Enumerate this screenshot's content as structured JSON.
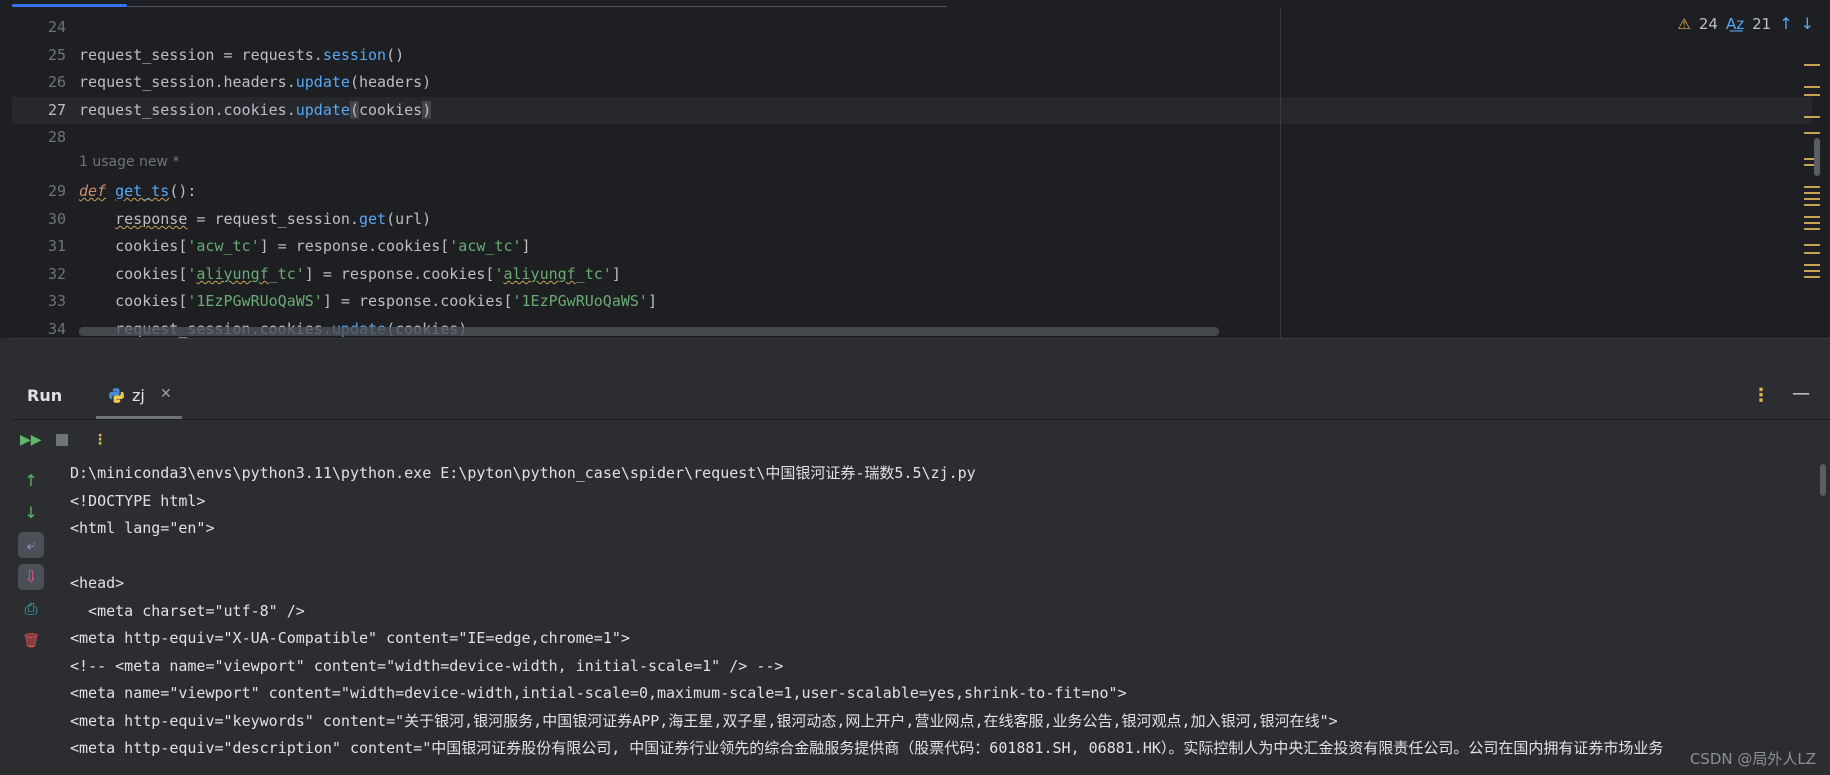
{
  "editor": {
    "line_numbers": [
      "24",
      "25",
      "26",
      "27",
      "28",
      "29",
      "30",
      "31",
      "32",
      "33",
      "34"
    ],
    "current_line": "27",
    "usage_hint": "1 usage   new *",
    "code": {
      "l25": {
        "a": "request_session = requests.",
        "fn": "session",
        "b": "()"
      },
      "l26": {
        "a": "request_session.headers.",
        "fn": "update",
        "b": "(headers)"
      },
      "l27": {
        "a": "request_session.cookies.",
        "fn": "update",
        "p1": "(",
        "arg": "cookies",
        "p2": ")"
      },
      "l29": {
        "kw": "def",
        "sp": " ",
        "name": "get_ts",
        "rest": "():"
      },
      "l30": {
        "indent": "    ",
        "var": "response",
        "a": " = request_session.",
        "fn": "get",
        "b": "(url)"
      },
      "l31": {
        "a": "    cookies[",
        "s1": "'acw_tc'",
        "b": "] = response.cookies[",
        "s2": "'acw_tc'",
        "c": "]"
      },
      "l32": {
        "a": "    cookies[",
        "s1q": "'",
        "s1u": "aliyungf",
        "s1r": "_tc'",
        "b": "] = response.cookies[",
        "s2q": "'",
        "s2u": "aliyungf",
        "s2r": "_tc'",
        "c": "]"
      },
      "l33": {
        "a": "    cookies[",
        "s1": "'1EzPGwRUoQaWS'",
        "b": "] = response.cookies[",
        "s2": "'1EzPGwRUoQaWS'",
        "c": "]"
      },
      "l34": {
        "a": "    request_session.cookies.",
        "fn": "update",
        "b": "(cookies)"
      }
    },
    "inspections": {
      "warnings": "24",
      "typos": "21",
      "up": "↑",
      "down": "↓"
    }
  },
  "run": {
    "title": "Run",
    "tab_label": "zj",
    "tab_close": "✕",
    "more": "⋮",
    "minimize": "—",
    "toolbar": {
      "rerun": "▶▶",
      "more": "⋮"
    },
    "side": {
      "up": "↑",
      "down": "↓",
      "wrap": "⤶",
      "scroll_end": "⇩",
      "print": "⎙",
      "delete": "🗑"
    },
    "console_lines": [
      "D:\\miniconda3\\envs\\python3.11\\python.exe E:\\pyton\\python_case\\spider\\request\\中国银河证券-瑞数5.5\\zj.py",
      "<!DOCTYPE html>",
      "<html lang=\"en\">",
      "",
      "<head>",
      "  <meta charset=\"utf-8\" />",
      "<meta http-equiv=\"X-UA-Compatible\" content=\"IE=edge,chrome=1\">",
      "<!-- <meta name=\"viewport\" content=\"width=device-width, initial-scale=1\" /> -->",
      "<meta name=\"viewport\" content=\"width=device-width,intial-scale=0,maximum-scale=1,user-scalable=yes,shrink-to-fit=no\">",
      "<meta http-equiv=\"keywords\" content=\"关于银河,银河服务,中国银河证券APP,海王星,双子星,银河动态,网上开户,营业网点,在线客服,业务公告,银河观点,加入银河,银河在线\">",
      "<meta http-equiv=\"description\" content=\"中国银河证券股份有限公司, 中国证券行业领先的综合金融服务提供商（股票代码：601881.SH, 06881.HK）。实际控制人为中央汇金投资有限责任公司。公司在国内拥有证券市场业务"
    ],
    "watermark": "CSDN @局外人LZ"
  },
  "colors": {
    "background": "#1e1f22",
    "panel": "#2b2d30",
    "keyword": "#cf8e6d",
    "function": "#56a8f5",
    "string": "#6aab73",
    "warning": "#e0b64f",
    "run": "#5fb865"
  }
}
